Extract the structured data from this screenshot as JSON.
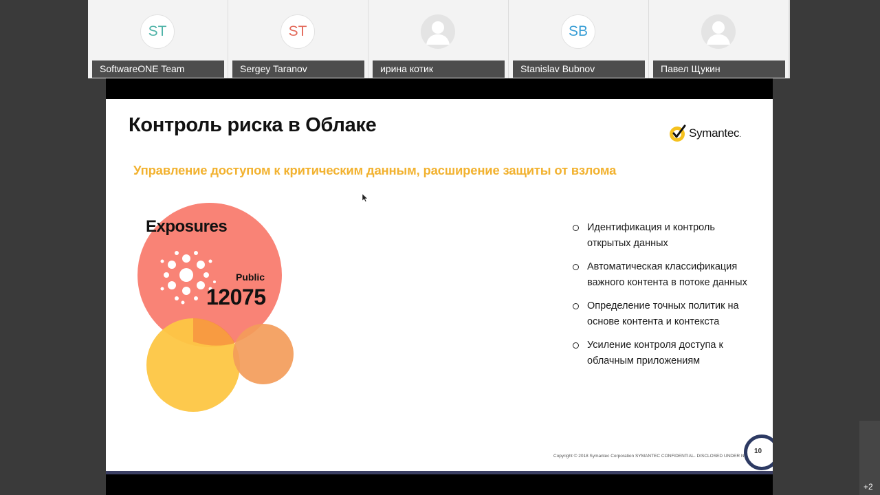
{
  "participants": [
    {
      "name": "SoftwareONE Team",
      "initials": "ST",
      "color": "#4fb3a8"
    },
    {
      "name": "Sergey Taranov",
      "initials": "ST",
      "color": "#e36a5b"
    },
    {
      "name": "ирина котик",
      "initials": "",
      "color": ""
    },
    {
      "name": "Stanislav Bubnov",
      "initials": "SB",
      "color": "#3a9fd6"
    },
    {
      "name": "Павел Щукин",
      "initials": "",
      "color": ""
    }
  ],
  "slide": {
    "title": "Контроль риска в Облаке",
    "logo": "Symantec",
    "logo_suffix": ".",
    "subtitle": "Управление доступом к критическим данным, расширение защиты от взлома",
    "exposures_label": "Exposures",
    "public_label": "Public",
    "public_value": "12075",
    "bullets": [
      "Идентификация и контроль открытых данных",
      "Автоматическая классификация важного контента в потоке данных",
      "Определение точных политик на основе контента и контекста",
      "Усиление контроля доступа к облачным приложениям"
    ],
    "copyright": "Copyright © 2018 Symantec Corporation SYMANTEC CONFIDENTIAL- DISCLOSED UNDER NDA",
    "page_number": "10"
  },
  "more_participants": "+2",
  "colors": {
    "accent_yellow": "#f2b230",
    "bubble_red": "#f8786a",
    "bubble_yellow": "#fdc643",
    "bubble_orange": "#f39c5a",
    "footer_bar": "#3b3f63"
  }
}
